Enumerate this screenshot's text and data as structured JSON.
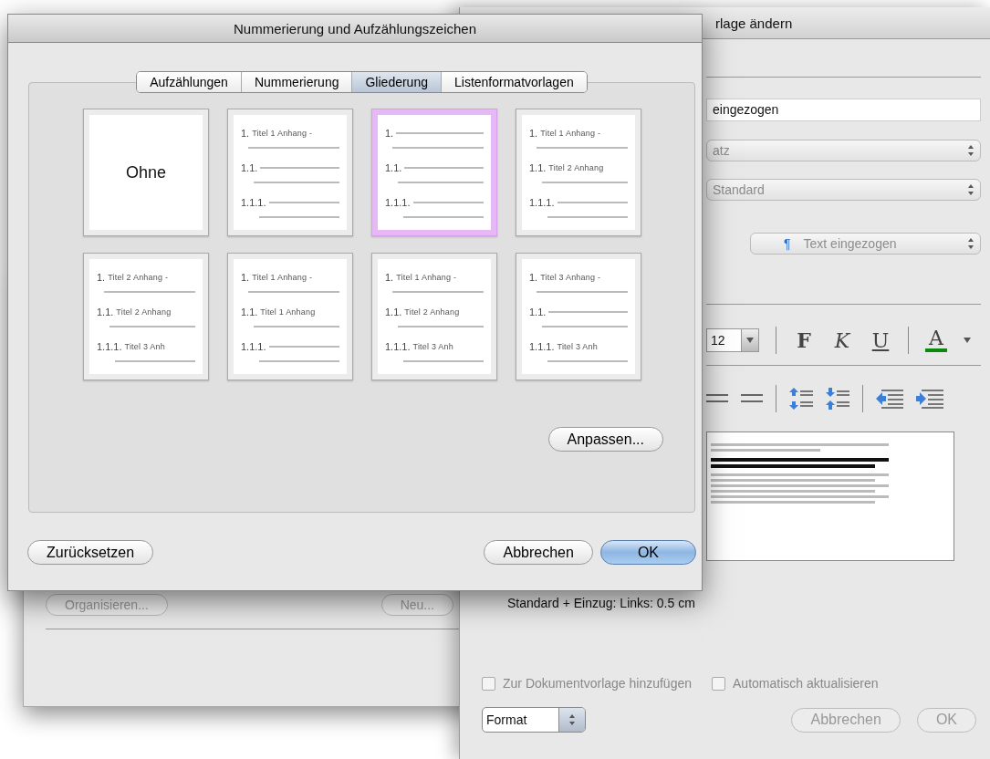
{
  "background_window": {
    "buttons": [
      {
        "label": "Organisieren..."
      },
      {
        "label": "Neu..."
      }
    ]
  },
  "style_window": {
    "title": "rlage ändern",
    "name_field": {
      "value": "eingezogen"
    },
    "style_type_popup": {
      "value": "atz",
      "disabled": true
    },
    "based_on_popup": {
      "value": "Standard",
      "disabled": true
    },
    "next_style_popup": {
      "icon": "¶",
      "value": "Text eingezogen",
      "disabled": true
    },
    "font_size": "12",
    "format_buttons": [
      {
        "kind": "bold",
        "label": "F"
      },
      {
        "kind": "italic",
        "label": "K"
      },
      {
        "kind": "underline",
        "label": "U"
      },
      {
        "kind": "color",
        "label": "A"
      }
    ],
    "description": "Standard + Einzug: Links:  0.5 cm",
    "checkboxes": [
      {
        "label": "Zur Dokumentvorlage hinzufügen",
        "checked": false
      },
      {
        "label": "Automatisch aktualisieren",
        "checked": false
      }
    ],
    "format_popup": {
      "value": "Format"
    },
    "buttons": [
      {
        "label": "Abbrechen",
        "disabled": true
      },
      {
        "label": "OK",
        "disabled": true
      }
    ]
  },
  "dialog": {
    "title": "Nummerierung und Aufzählungszeichen",
    "tabs": [
      {
        "label": "Aufzählungen",
        "selected": false
      },
      {
        "label": "Nummerierung",
        "selected": false
      },
      {
        "label": "Gliederung",
        "selected": true
      },
      {
        "label": "Listenformatvorlagen",
        "selected": false
      }
    ],
    "options": [
      {
        "kind": "none",
        "label": "Ohne",
        "selected": false
      },
      {
        "kind": "outline",
        "selected": false,
        "lines": [
          {
            "number": "1.",
            "text": "Titel 1 Anhang -"
          },
          {
            "number": "1.1."
          },
          {
            "number": "1.1.1."
          }
        ]
      },
      {
        "kind": "outline",
        "selected": true,
        "lines": [
          {
            "number": "1."
          },
          {
            "number": "1.1."
          },
          {
            "number": "1.1.1."
          }
        ]
      },
      {
        "kind": "outline",
        "selected": false,
        "lines": [
          {
            "number": "1.",
            "text": "Titel 1 Anhang -"
          },
          {
            "number": "1.1.",
            "text": "Titel 2 Anhang"
          },
          {
            "number": "1.1.1."
          }
        ]
      },
      {
        "kind": "outline",
        "selected": false,
        "lines": [
          {
            "number": "1.",
            "text": "Titel 2 Anhang -"
          },
          {
            "number": "1.1.",
            "text": "Titel 2 Anhang"
          },
          {
            "number": "1.1.1.",
            "text": "Titel 3 Anh"
          }
        ]
      },
      {
        "kind": "outline",
        "selected": false,
        "lines": [
          {
            "number": "1.",
            "text": "Titel 1 Anhang -"
          },
          {
            "number": "1.1.",
            "text": "Titel 1 Anhang"
          },
          {
            "number": "1.1.1."
          }
        ]
      },
      {
        "kind": "outline",
        "selected": false,
        "lines": [
          {
            "number": "1.",
            "text": "Titel 1 Anhang -"
          },
          {
            "number": "1.1.",
            "text": "Titel 2 Anhang"
          },
          {
            "number": "1.1.1.",
            "text": "Titel 3 Anh"
          }
        ]
      },
      {
        "kind": "outline",
        "selected": false,
        "lines": [
          {
            "number": "1.",
            "text": "Titel 3 Anhang -"
          },
          {
            "number": "1.1."
          },
          {
            "number": "1.1.1.",
            "text": "Titel 3 Anh"
          }
        ]
      }
    ],
    "customize_button": "Anpassen...",
    "reset_button": "Zurücksetzen",
    "buttons": [
      {
        "label": "Abbrechen",
        "default": false
      },
      {
        "label": "OK",
        "default": true
      }
    ]
  }
}
